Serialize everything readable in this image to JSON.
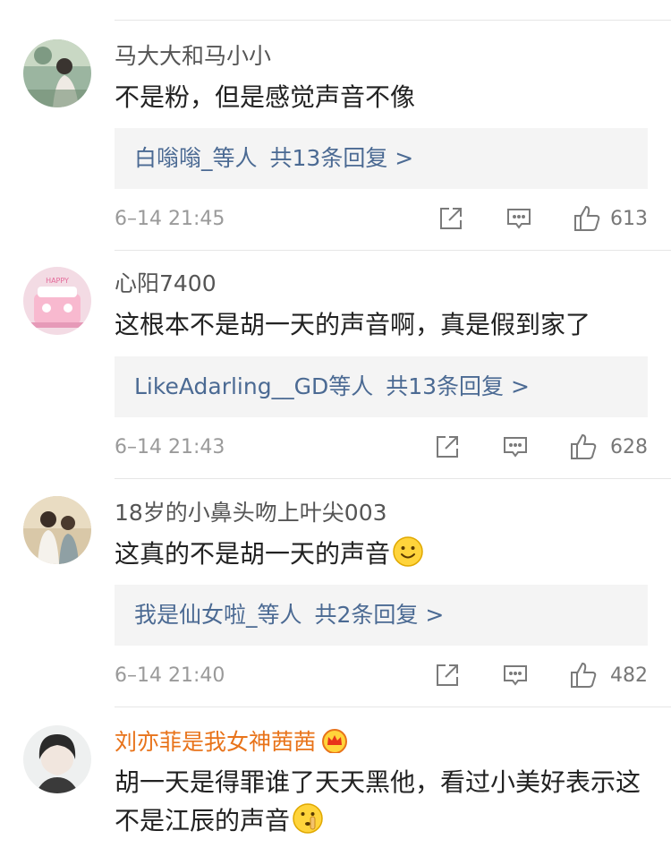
{
  "comments": [
    {
      "user": "马大大和马小小",
      "text": "不是粉，但是感觉声音不像",
      "reply_who": "白嗡嗡_等人",
      "reply_count": "共13条回复 >",
      "time": "6–14 21:45",
      "likes": "613"
    },
    {
      "user": "心阳7400",
      "text": "这根本不是胡一天的声音啊，真是假到家了",
      "reply_who": "LikeAdarling__GD等人",
      "reply_count": "共13条回复 >",
      "time": "6–14 21:43",
      "likes": "628"
    },
    {
      "user": "18岁的小鼻头吻上叶尖003",
      "text": "这真的不是胡一天的声音",
      "reply_who": "我是仙女啦_等人",
      "reply_count": "共2条回复 >",
      "time": "6–14 21:40",
      "likes": "482"
    },
    {
      "user": "刘亦菲是我女神茜茜",
      "text": "胡一天是得罪谁了天天黑他，看过小美好表示这不是江辰的声音"
    }
  ],
  "icons": {
    "share": "share-icon",
    "comment": "comment-icon",
    "like": "thumbs-up-icon",
    "crown": "vip-crown-icon",
    "smile": "smile-emoji",
    "shush": "shush-emoji"
  },
  "colors": {
    "link": "#4b6a93",
    "vip_name": "#e8731a",
    "reply_bg": "#f4f4f4"
  }
}
